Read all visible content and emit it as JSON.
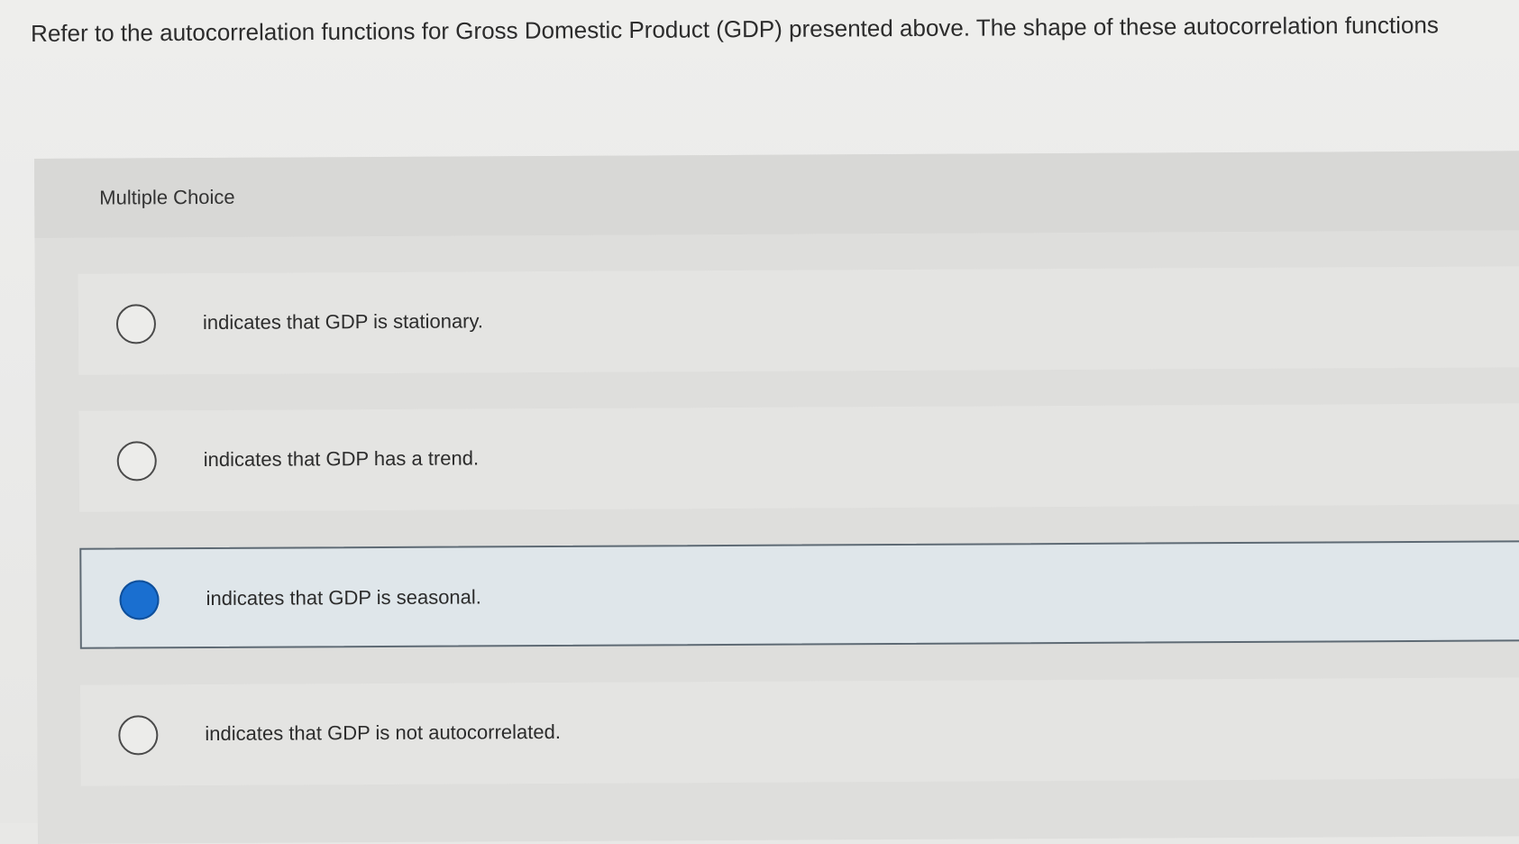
{
  "question": {
    "text": "Refer to the autocorrelation functions for Gross Domestic Product (GDP) presented above. The shape of these autocorrelation functions"
  },
  "multiple_choice": {
    "title": "Multiple Choice",
    "options": [
      {
        "label": "indicates that GDP is stationary.",
        "selected": false
      },
      {
        "label": "indicates that GDP has a trend.",
        "selected": false
      },
      {
        "label": "indicates that GDP is seasonal.",
        "selected": true
      },
      {
        "label": "indicates that GDP is not autocorrelated.",
        "selected": false
      }
    ]
  },
  "colors": {
    "selected_radio": "#1a6fd0",
    "selected_background": "#dfe6ea",
    "panel_background": "#dededc"
  }
}
